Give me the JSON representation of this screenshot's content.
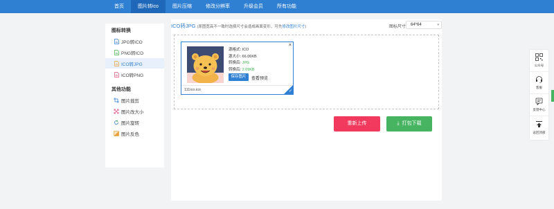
{
  "nav": {
    "items": [
      {
        "label": "首页",
        "active": false
      },
      {
        "label": "图片转ico",
        "active": true
      },
      {
        "label": "图片压缩",
        "active": false
      },
      {
        "label": "修改分辨率",
        "active": false
      },
      {
        "label": "升级会员",
        "active": false
      },
      {
        "label": "所有功能",
        "active": false
      }
    ]
  },
  "sidebar": {
    "section1_title": "图标转换",
    "section1_items": [
      {
        "label": "JPG转ICO",
        "icon": "file-icon"
      },
      {
        "label": "PNG转ICO",
        "icon": "file-icon"
      },
      {
        "label": "ICO转JPG",
        "icon": "file-icon",
        "active": true
      },
      {
        "label": "ICO转PNG",
        "icon": "file-icon"
      }
    ],
    "section2_title": "其他功能",
    "section2_items": [
      {
        "label": "图片裁剪",
        "icon": "crop-icon"
      },
      {
        "label": "图片改大小",
        "icon": "resize-icon"
      },
      {
        "label": "图片旋转",
        "icon": "rotate-icon"
      },
      {
        "label": "图片反色",
        "icon": "invert-icon"
      }
    ]
  },
  "main": {
    "title": "ICO转JPG",
    "subtitle_prefix": "(原图宽高不一致时选择尺寸会造成画面变形，可先",
    "subtitle_link": "修改图片尺寸",
    "subtitle_suffix": ")",
    "size_label": "图标尺寸",
    "size_value": "64*64"
  },
  "card": {
    "source_format": "源格式: ICO",
    "source_size": "源大小: 66.06KB",
    "converted_format_label": "转换后: ",
    "converted_format_value": "JPG",
    "converted_size_label": "转换后: ",
    "converted_size_value": "2.09KB",
    "save_button": "保存图片",
    "view_link": "查看预览",
    "close": "×",
    "filename": "111ico.ico",
    "check": "✓"
  },
  "actions": {
    "reupload": "重新上传",
    "download": "打包下载",
    "download_icon": "⤓"
  },
  "rightbar": {
    "items": [
      {
        "label": "公众号",
        "icon": "qrcode-icon"
      },
      {
        "label": "客服",
        "icon": "headset-icon"
      },
      {
        "label": "反馈中心",
        "icon": "feedback-icon"
      },
      {
        "label": "返回顶部",
        "icon": "back-to-top-icon"
      }
    ]
  },
  "colors": {
    "nav_bg": "#2f7fd3",
    "accent": "#2f7fd3",
    "reupload": "#f13a5d",
    "download": "#46b461",
    "success_text": "#3cb44b"
  }
}
